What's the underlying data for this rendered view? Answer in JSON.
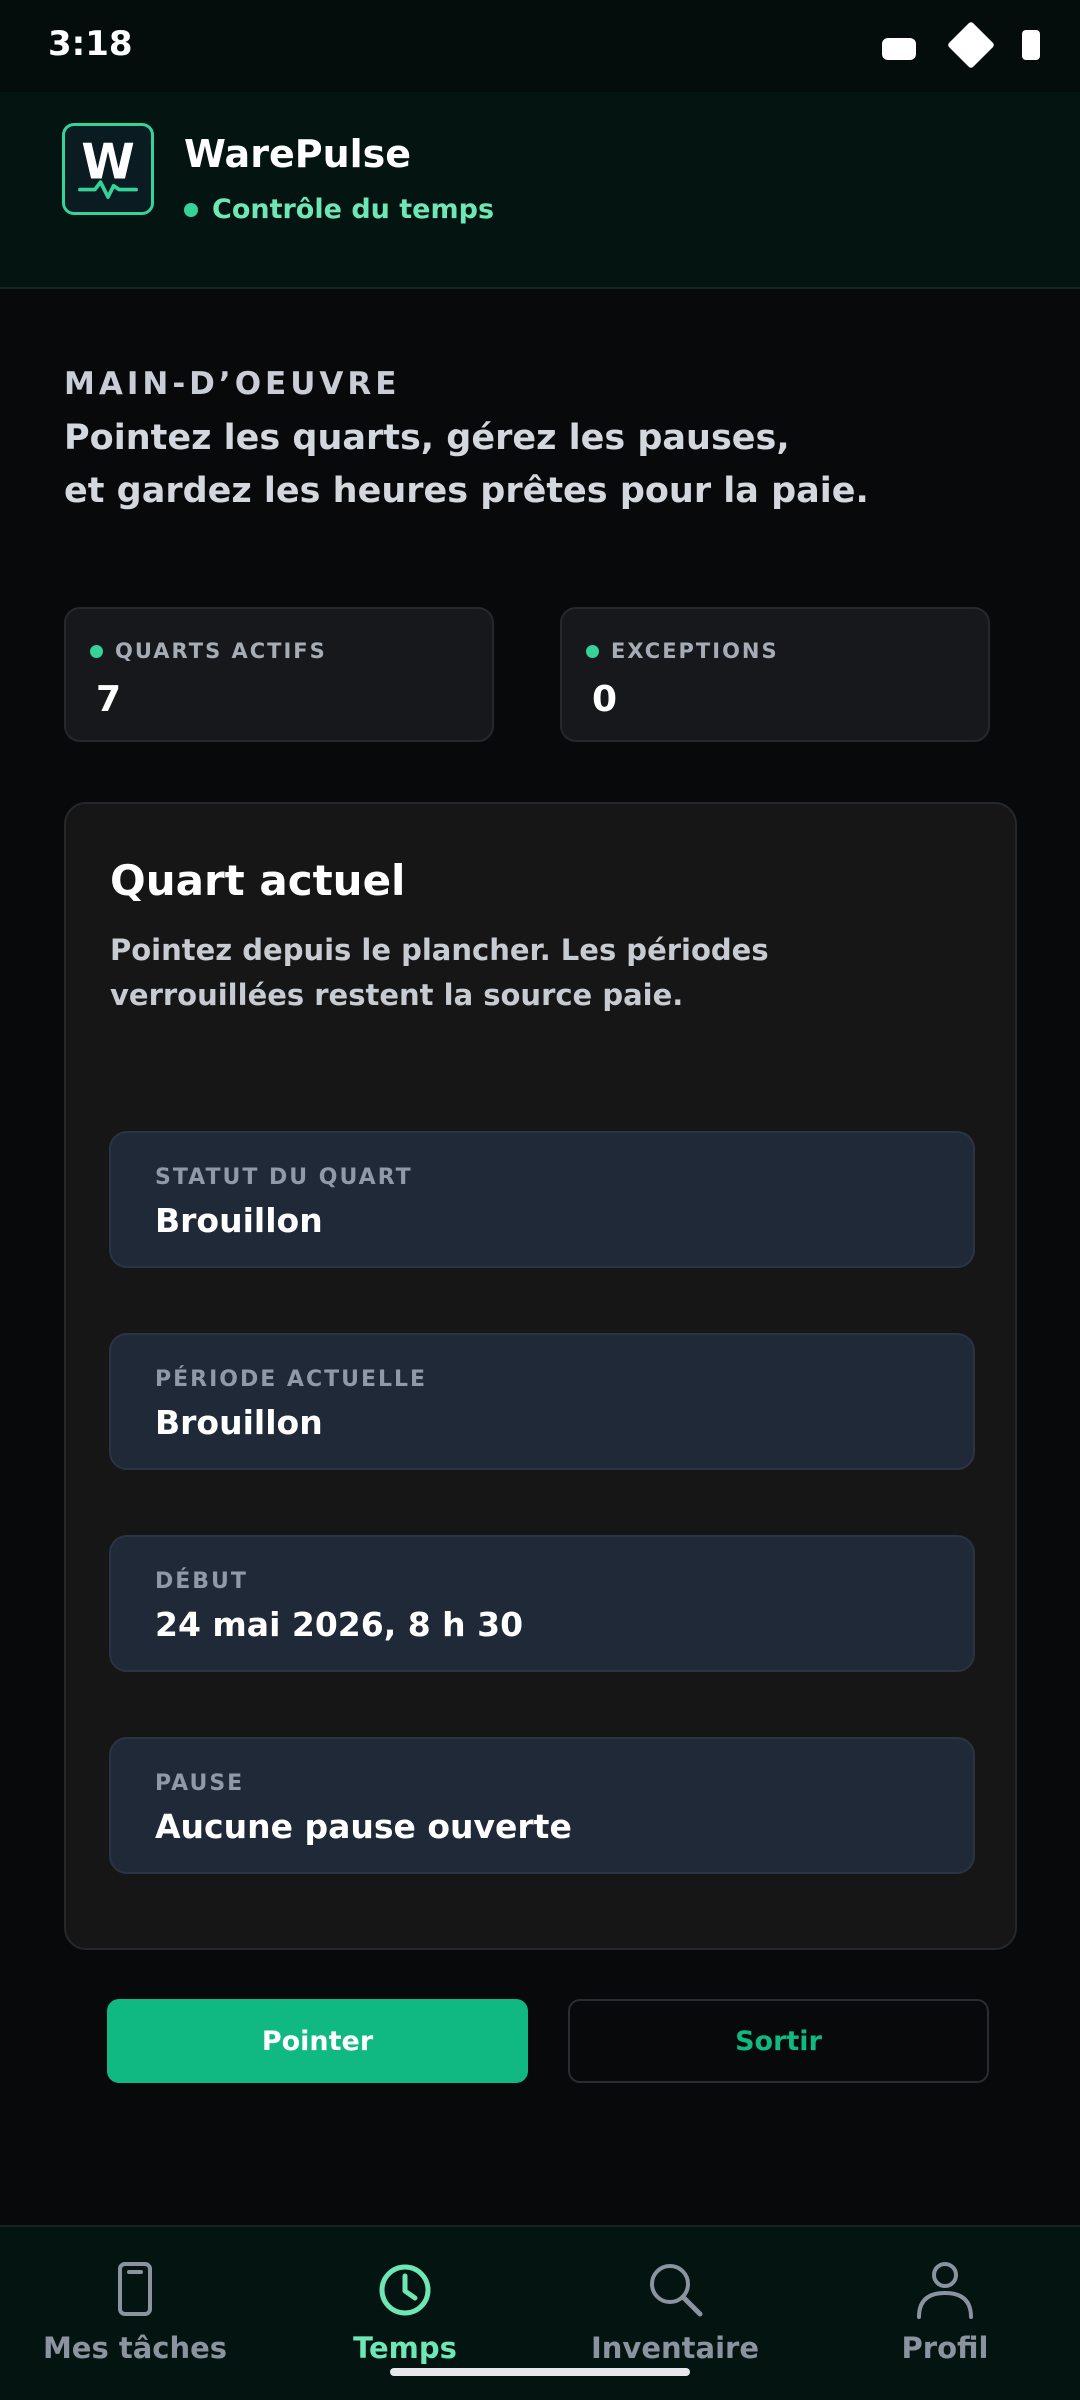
{
  "status_bar": {
    "time": "3:18"
  },
  "header": {
    "logo_letter": "W",
    "app_name": "WarePulse",
    "subtitle": "Contrôle du temps"
  },
  "hero": {
    "kicker": "MAIN-D’OEUVRE",
    "line1": "Pointez les quarts, gérez les pauses,",
    "line2": "et gardez les heures prêtes pour la paie."
  },
  "stats": [
    {
      "label": "QUARTS ACTIFS",
      "value": "7"
    },
    {
      "label": "EXCEPTIONS",
      "value": "0"
    }
  ],
  "shift": {
    "title": "Quart actuel",
    "desc_line1": "Pointez depuis le plancher. Les périodes",
    "desc_line2": "verrouillées restent la source paie.",
    "fields": [
      {
        "label": "STATUT DU QUART",
        "value": "Brouillon"
      },
      {
        "label": "PÉRIODE ACTUELLE",
        "value": "Brouillon"
      },
      {
        "label": "DÉBUT",
        "value": "24 mai 2026, 8 h 30"
      },
      {
        "label": "PAUSE",
        "value": "Aucune pause ouverte"
      }
    ]
  },
  "actions": {
    "primary": "Pointer",
    "secondary": "Sortir"
  },
  "nav": {
    "active": "Temps",
    "items": [
      {
        "label": "Mes tâches",
        "icon": "phone-icon"
      },
      {
        "label": "Temps",
        "icon": "clock-icon"
      },
      {
        "label": "Inventaire",
        "icon": "search-icon"
      },
      {
        "label": "Profil",
        "icon": "person-icon"
      }
    ]
  },
  "colors": {
    "accent": "#10b981",
    "accent_light": "#6ee7b7",
    "field_bg": "#1f2937",
    "header_bg": "#041511"
  }
}
